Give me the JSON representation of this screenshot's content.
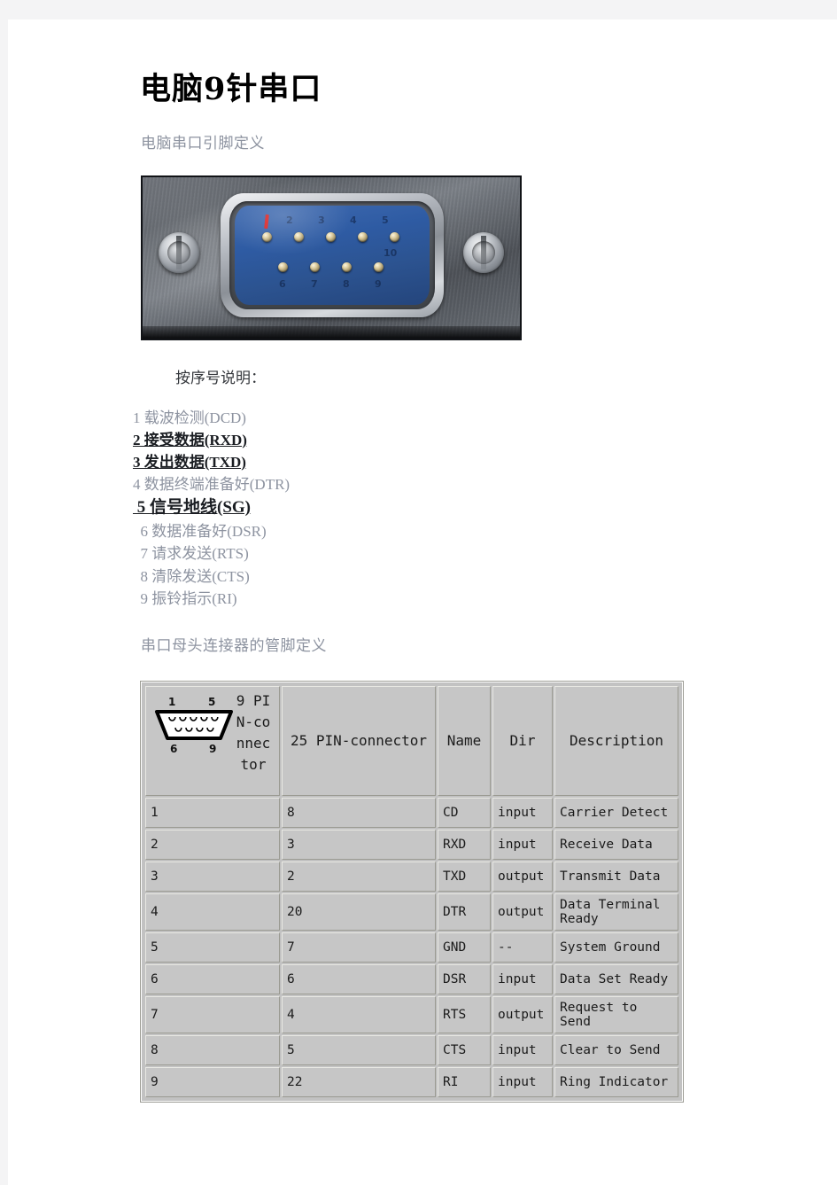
{
  "page": {
    "title": "电脑9针串口",
    "section_1_label": "电脑串口引脚定义",
    "section_2_label": "串口母头连接器的管脚定义",
    "pin_note": "按序号说明：",
    "background_color": "#f4f4f5",
    "page_color": "#ffffff",
    "muted_text_color": "#8d93a0",
    "emphasis_text_color": "#1a1d22"
  },
  "photo": {
    "alt_name": "db9-male-serial-port-photo",
    "top_row_numbers": [
      "1",
      "2",
      "3",
      "4",
      "5"
    ],
    "bottom_row_numbers": [
      "6",
      "7",
      "8",
      "9"
    ],
    "marker_color": "#d81f1f",
    "insert_color": "#2e5ba3",
    "shell_color": "#8b9097"
  },
  "pin_list": [
    {
      "num": "1",
      "text": "1 载波检测(DCD)",
      "emphasis": false
    },
    {
      "num": "2",
      "text": "2 接受数据(RXD)",
      "emphasis": true
    },
    {
      "num": "3",
      "text": "3 发出数据(TXD)",
      "emphasis": true
    },
    {
      "num": "4",
      "text": "4 数据终端准备好(DTR)",
      "emphasis": false
    },
    {
      "num": "5",
      "text": " 5 信号地线(SG)",
      "emphasis": true
    },
    {
      "num": "6",
      "text": "  6 数据准备好(DSR)",
      "emphasis": false
    },
    {
      "num": "7",
      "text": "  7 请求发送(RTS)",
      "emphasis": false
    },
    {
      "num": "8",
      "text": "  8 清除发送(CTS)",
      "emphasis": false
    },
    {
      "num": "9",
      "text": "  9 振铃指示(RI)",
      "emphasis": false
    }
  ],
  "table": {
    "figure_labels": {
      "top_left": "1",
      "top_right": "5",
      "bottom_left": "6",
      "bottom_right": "9"
    },
    "headers": {
      "col_9pin": "9 PIN-connector",
      "col_25pin": "25 PIN-connector",
      "col_name": "Name",
      "col_dir": "Dir",
      "col_desc": "Description"
    },
    "rows": [
      {
        "pin9": "1",
        "pin25": "8",
        "name": "CD",
        "dir": "input",
        "desc": "Carrier Detect"
      },
      {
        "pin9": "2",
        "pin25": "3",
        "name": "RXD",
        "dir": "input",
        "desc": "Receive Data"
      },
      {
        "pin9": "3",
        "pin25": "2",
        "name": "TXD",
        "dir": "output",
        "desc": "Transmit Data"
      },
      {
        "pin9": "4",
        "pin25": "20",
        "name": "DTR",
        "dir": "output",
        "desc": "Data Terminal Ready"
      },
      {
        "pin9": "5",
        "pin25": "7",
        "name": "GND",
        "dir": "--",
        "desc": "System Ground"
      },
      {
        "pin9": "6",
        "pin25": "6",
        "name": "DSR",
        "dir": "input",
        "desc": "Data Set Ready"
      },
      {
        "pin9": "7",
        "pin25": "4",
        "name": "RTS",
        "dir": "output",
        "desc": "Request to Send"
      },
      {
        "pin9": "8",
        "pin25": "5",
        "name": "CTS",
        "dir": "input",
        "desc": "Clear to Send"
      },
      {
        "pin9": "9",
        "pin25": "22",
        "name": "RI",
        "dir": "input",
        "desc": "Ring Indicator"
      }
    ]
  }
}
